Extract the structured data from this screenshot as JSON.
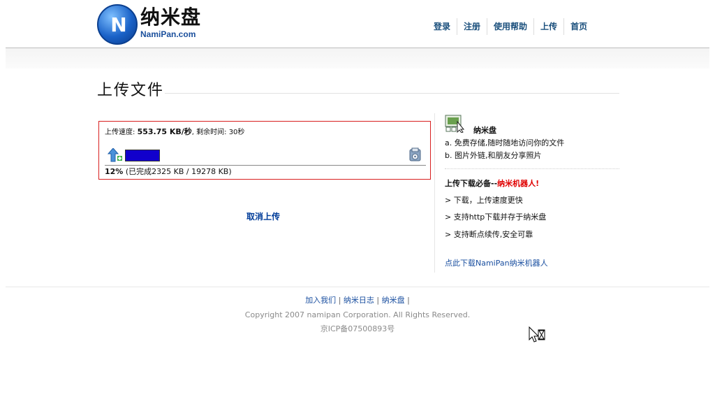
{
  "header": {
    "logo_title": "纳米盘",
    "logo_sub": "NamiPan.com",
    "nav": [
      "登录",
      "注册",
      "使用帮助",
      "上传",
      "首页"
    ]
  },
  "main": {
    "page_title": "上传文件",
    "upload": {
      "speed_label": "上传速度:",
      "speed_value": "553.75 KB/秒",
      "remaining_label": ", 剩余时间:",
      "remaining_value": "30秒",
      "percent": "12%",
      "percent_value": 0.12,
      "detail": "(已完成2325 KB / 19278 KB)"
    },
    "cancel_label": "取消上传"
  },
  "sidebar": {
    "brand": "纳米盘",
    "features": [
      "a. 免费存储,随时随地访问你的文件",
      "b. 图片外链,和朋友分享照片"
    ],
    "must_have_prefix": "上传下载必备--",
    "must_have_highlight": "纳米机器人!",
    "points": [
      "> 下载，上传速度更快",
      "> 支持http下载并存于纳米盘",
      "> 支持断点续传,安全可靠"
    ],
    "download_link": "点此下载NamiPan纳米机器人"
  },
  "footer": {
    "links": [
      "加入我们",
      "纳米日志",
      "纳米盘"
    ],
    "copyright": "Copyright 2007 namipan Corporation. All Rights Reserved.",
    "icp": "京ICP备07500893号"
  },
  "colors": {
    "accent": "#1a4f7c",
    "progress": "#1100cc",
    "alert_border": "#d81f1f",
    "highlight": "#e00000"
  },
  "icons": [
    "namipan-logo",
    "upload-arrow-icon",
    "disk-icon",
    "screen-icon",
    "busy-cursor-icon"
  ]
}
